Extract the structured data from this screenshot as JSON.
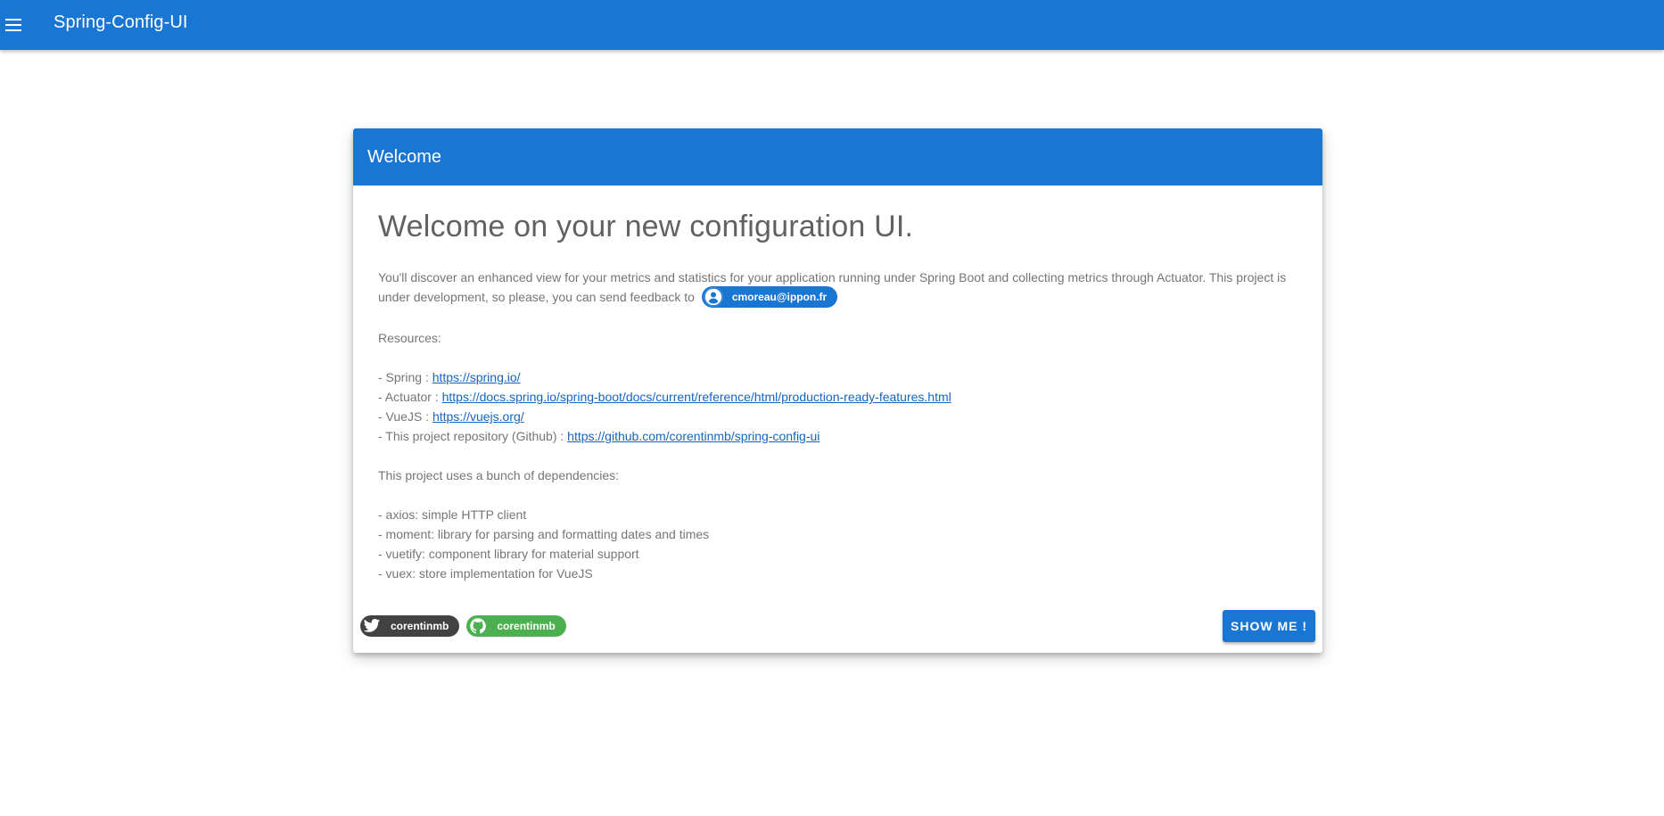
{
  "app_bar": {
    "menu_icon": "hamburger-menu-icon",
    "title": "Spring-Config-UI",
    "color": "#1976d2"
  },
  "card": {
    "header_title": "Welcome",
    "headline": "Welcome on your new configuration UI.",
    "intro_text": "You'll discover an enhanced view for your metrics and statistics for your application running under Spring Boot and collecting metrics through Actuator. This project is under development, so please, you can send feedback to",
    "email_chip": {
      "icon": "account-circle-icon",
      "label": "cmoreau@ippon.fr"
    },
    "resources_heading": "Resources:",
    "resources": [
      {
        "prefix": "- Spring : ",
        "link": "https://spring.io/"
      },
      {
        "prefix": "- Actuator : ",
        "link": "https://docs.spring.io/spring-boot/docs/current/reference/html/production-ready-features.html"
      },
      {
        "prefix": "- VueJS : ",
        "link": "https://vuejs.org/"
      },
      {
        "prefix": "- This project repository (Github) : ",
        "link": "https://github.com/corentinmb/spring-config-ui"
      }
    ],
    "dependencies_heading": "This project uses a bunch of dependencies:",
    "dependencies": [
      "- axios: simple HTTP client",
      "- moment: library for parsing and formatting dates and times",
      "- vuetify: component library for material support",
      "- vuex: store implementation for VueJS"
    ],
    "actions": {
      "twitter_chip": {
        "icon": "twitter-icon",
        "label": "corentinmb",
        "color": "#424242"
      },
      "github_chip": {
        "icon": "github-icon",
        "label": "corentinmb",
        "color": "#4caf50"
      },
      "show_button_label": "SHOW ME !"
    }
  }
}
